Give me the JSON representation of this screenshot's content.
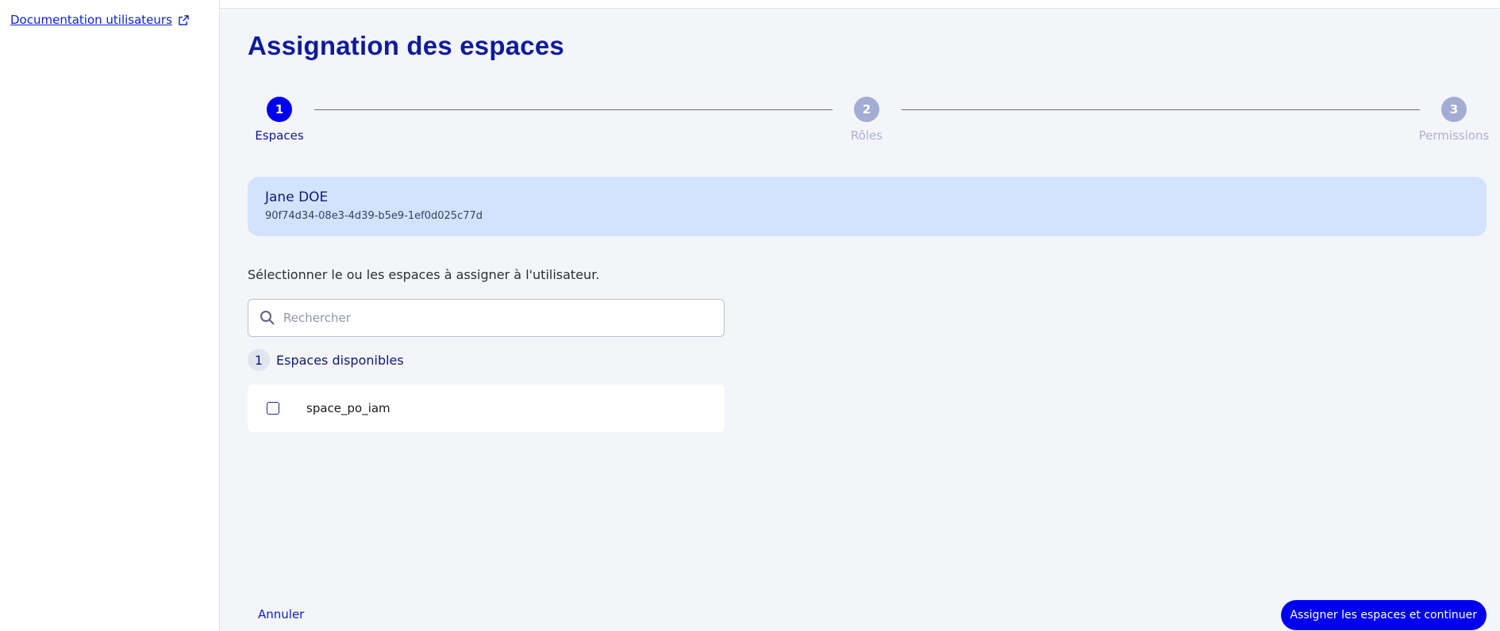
{
  "sidebar": {
    "doc_link_label": "Documentation utilisateurs",
    "doc_link_icon": "external-link-icon"
  },
  "page": {
    "title": "Assignation des espaces"
  },
  "stepper": {
    "steps": [
      {
        "number": "1",
        "label": "Espaces",
        "state": "active"
      },
      {
        "number": "2",
        "label": "Rôles",
        "state": "inactive"
      },
      {
        "number": "3",
        "label": "Permissions",
        "state": "inactive"
      }
    ]
  },
  "user": {
    "name": "Jane DOE",
    "id": "90f74d34-08e3-4d39-b5e9-1ef0d025c77d"
  },
  "instructions": "Sélectionner le ou les espaces à assigner à l'utilisateur.",
  "search": {
    "placeholder": "Rechercher",
    "value": "",
    "icon": "search-icon"
  },
  "available": {
    "count": "1",
    "label": "Espaces disponibles"
  },
  "spaces": [
    {
      "name": "space_po_iam",
      "checked": false
    }
  ],
  "footer": {
    "cancel_label": "Annuler",
    "submit_label": "Assigner les espaces et continuer"
  },
  "colors": {
    "primary": "#0000ee",
    "title": "#0d1b9c",
    "card_bg": "#d3e3fd",
    "step_inactive": "#a3acd3"
  }
}
